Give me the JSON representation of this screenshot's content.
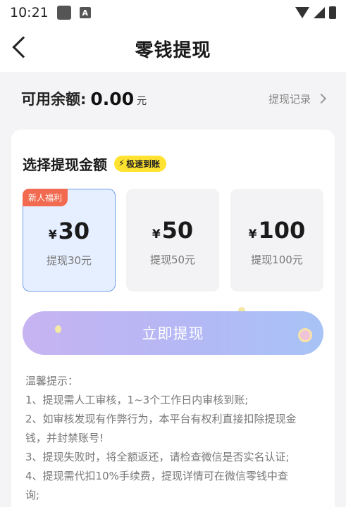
{
  "status_bar": {
    "time": "10:21"
  },
  "header": {
    "title": "零钱提现"
  },
  "balance": {
    "label": "可用余额:",
    "value": "0.00",
    "unit": "元",
    "records_label": "提现记录"
  },
  "select": {
    "title": "选择提现金额",
    "badge": "极速到账",
    "options": [
      {
        "currency": "¥",
        "amount": "30",
        "sub": "提现30元",
        "tag": "新人福利",
        "selected": true
      },
      {
        "currency": "¥",
        "amount": "50",
        "sub": "提现50元",
        "selected": false
      },
      {
        "currency": "¥",
        "amount": "100",
        "sub": "提现100元",
        "selected": false
      }
    ]
  },
  "submit_label": "立即提现",
  "tips": {
    "title": "温馨提示：",
    "lines": [
      "1、提现需人工审核，1~3个工作日内审核到账;",
      "2、如审核发现有作弊行为，本平台有权利直接扣除提现金",
      "钱，并封禁账号!",
      "3、提现失败时，将全额返还，请检查微信是否实名认证;",
      "4、提现需代扣10%手续费，提现详情可在微信零钱中查",
      "询;"
    ]
  },
  "colors": {
    "accent_blue": "#6fa0ee",
    "badge_yellow": "#ffe330",
    "tag_orange": "#f26a4f",
    "button_start": "#c7b3f2",
    "button_end": "#a8c3f6"
  }
}
